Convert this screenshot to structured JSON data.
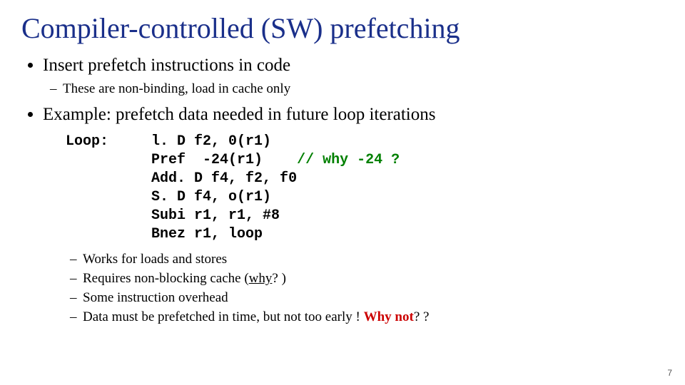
{
  "title": "Compiler-controlled (SW) prefetching",
  "bullets": {
    "b1": "Insert prefetch instructions in code",
    "b1_sub1": "These are non-binding, load in cache only",
    "b2": "Example: prefetch data needed in future loop iterations"
  },
  "code": {
    "label": "Loop:",
    "l1": "l. D f2, 0(r1)",
    "l2": "Pref  -24(r1)",
    "l2_comment": "// why -24 ?",
    "l3": "Add. D f4, f2, f0",
    "l4": "S. D f4, o(r1)",
    "l5": "Subi r1, r1, #8",
    "l6": "Bnez r1, loop"
  },
  "notes": {
    "n1": "Works for loads and stores",
    "n2_a": "Requires non-blocking cache (",
    "n2_why": "why",
    "n2_b": "? )",
    "n3": "Some instruction overhead",
    "n4_a": "Data must be prefetched in time, but not too early ! ",
    "n4_why": "Why not",
    "n4_b": "? ?"
  },
  "pagenum": "7"
}
